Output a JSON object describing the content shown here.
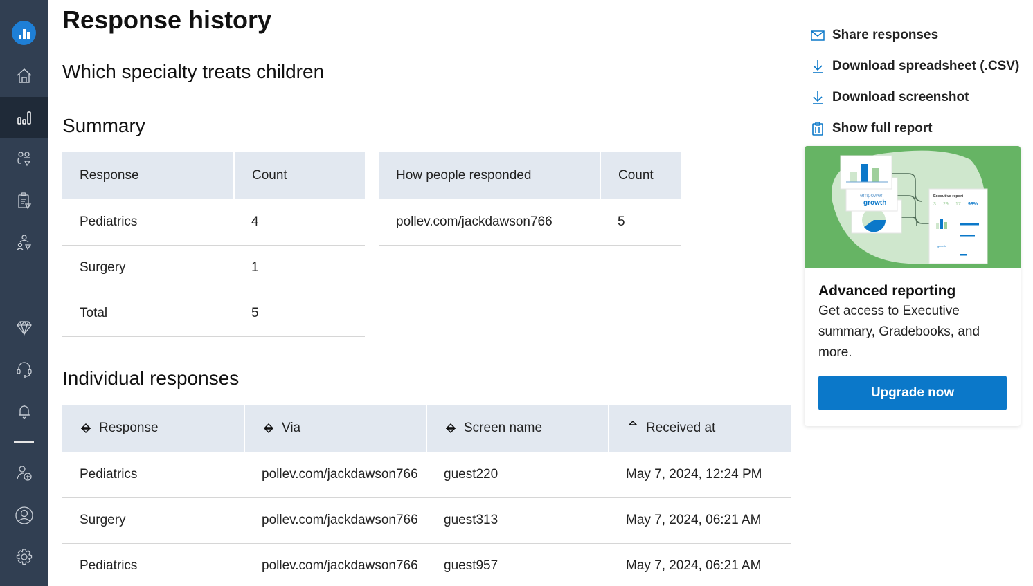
{
  "sidebar": {
    "logo": "poll-everywhere-logo-icon",
    "items": [
      {
        "name": "home",
        "icon": "home-icon",
        "active": false
      },
      {
        "name": "reports",
        "icon": "bar-chart-icon",
        "active": true
      },
      {
        "name": "participants",
        "icon": "participants-premium-icon",
        "active": false
      },
      {
        "name": "gradebook",
        "icon": "clipboard-premium-icon",
        "active": false
      },
      {
        "name": "groups",
        "icon": "groups-premium-icon",
        "active": false
      },
      {
        "name": "upgrade",
        "icon": "diamond-icon",
        "active": false
      },
      {
        "name": "support",
        "icon": "headset-icon",
        "active": false
      },
      {
        "name": "notifications",
        "icon": "bell-icon",
        "active": false
      },
      {
        "name": "add-user",
        "icon": "add-user-icon",
        "active": false
      },
      {
        "name": "profile",
        "icon": "user-circle-icon",
        "active": false
      },
      {
        "name": "settings",
        "icon": "gear-icon",
        "active": false
      }
    ]
  },
  "header": {
    "title": "Response history",
    "question": "Which specialty treats children"
  },
  "summary": {
    "heading": "Summary",
    "responses_table": {
      "columns": [
        "Response",
        "Count"
      ],
      "rows": [
        [
          "Pediatrics",
          "4"
        ],
        [
          "Surgery",
          "1"
        ],
        [
          "Total",
          "5"
        ]
      ]
    },
    "via_table": {
      "columns": [
        "How people responded",
        "Count"
      ],
      "rows": [
        [
          "pollev.com/jackdawson766",
          "5"
        ]
      ]
    }
  },
  "individual": {
    "heading": "Individual responses",
    "columns": [
      {
        "label": "Response",
        "sort": "unsorted"
      },
      {
        "label": "Via",
        "sort": "unsorted"
      },
      {
        "label": "Screen name",
        "sort": "unsorted"
      },
      {
        "label": "Received at",
        "sort": "ascending"
      }
    ],
    "rows": [
      [
        "Pediatrics",
        "pollev.com/jackdawson766",
        "guest220",
        "May 7, 2024, 12:24 PM"
      ],
      [
        "Surgery",
        "pollev.com/jackdawson766",
        "guest313",
        "May 7, 2024, 06:21 AM"
      ],
      [
        "Pediatrics",
        "pollev.com/jackdawson766",
        "guest957",
        "May 7, 2024, 06:21 AM"
      ]
    ]
  },
  "actions": [
    {
      "label": "Share responses",
      "icon": "envelope-icon"
    },
    {
      "label": "Download spreadsheet (.CSV)",
      "icon": "download-icon"
    },
    {
      "label": "Download screenshot",
      "icon": "download-icon"
    },
    {
      "label": "Show full report",
      "icon": "clipboard-icon"
    }
  ],
  "promo": {
    "image": {
      "card_text": [
        "empower",
        "growth"
      ],
      "report_title": "Executive report",
      "report_stats": [
        "3",
        "29",
        "17",
        "98%"
      ]
    },
    "title": "Advanced reporting",
    "text": "Get access to Executive summary, Gradebooks, and more.",
    "button": "Upgrade now"
  },
  "colors": {
    "sidebar_bg": "#313f52",
    "accent": "#0b78c9",
    "table_header_bg": "#e2e8f0",
    "promo_green": "#66b464"
  }
}
